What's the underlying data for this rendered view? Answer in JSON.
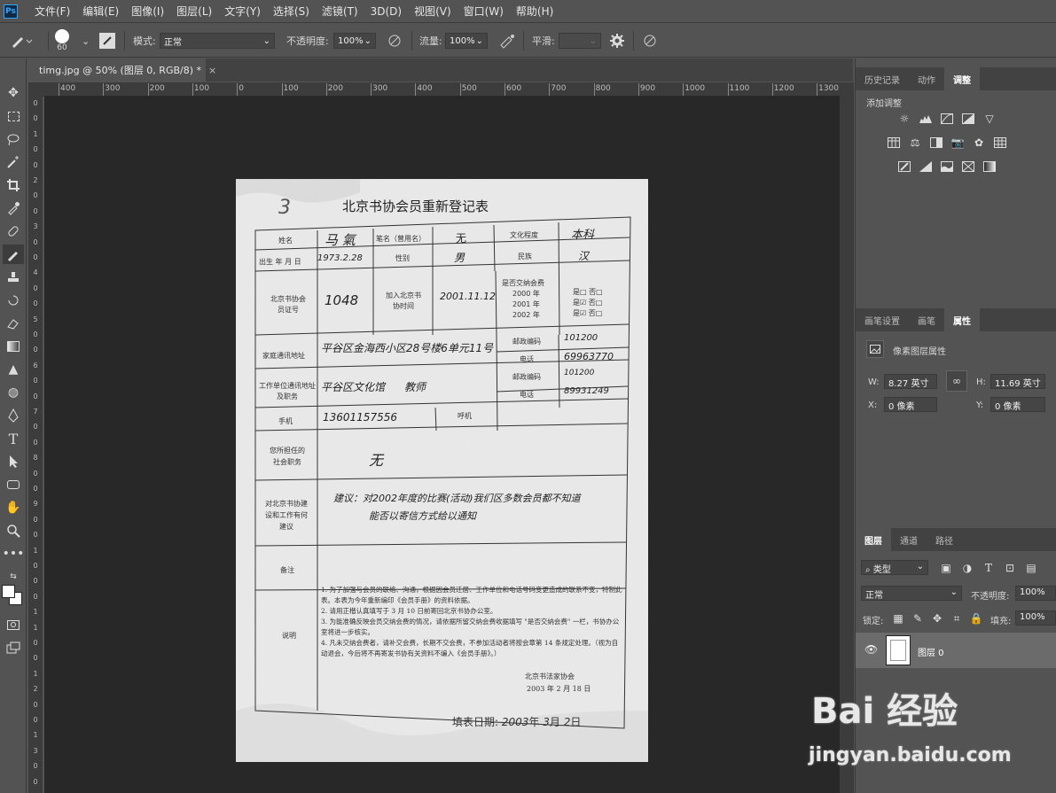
{
  "menubar": {
    "logo": "Ps",
    "items": [
      "文件(F)",
      "编辑(E)",
      "图像(I)",
      "图层(L)",
      "文字(Y)",
      "选择(S)",
      "滤镜(T)",
      "3D(D)",
      "视图(V)",
      "窗口(W)",
      "帮助(H)"
    ]
  },
  "options": {
    "brush_size": "60",
    "mode_label": "模式:",
    "mode_value": "正常",
    "opacity_label": "不透明度:",
    "opacity_value": "100%",
    "flow_label": "流量:",
    "flow_value": "100%",
    "smooth_label": "平滑:"
  },
  "document_tab": {
    "title": "timg.jpg @ 50% (图层 0, RGB/8) *",
    "close": "×"
  },
  "ruler": {
    "h_labels": [
      "400",
      "300",
      "200",
      "100",
      "0",
      "100",
      "200",
      "300",
      "400",
      "500",
      "600",
      "700",
      "800",
      "900",
      "1000",
      "1100",
      "1200",
      "1300"
    ],
    "v_labels": [
      "0",
      "0",
      "1",
      "0",
      "0",
      "2",
      "0",
      "0",
      "3",
      "0",
      "0",
      "4",
      "0",
      "0",
      "5",
      "0",
      "0",
      "6",
      "0",
      "0",
      "7",
      "0",
      "0",
      "8",
      "0",
      "0",
      "9",
      "0",
      "0",
      "1",
      "0",
      "0",
      "0",
      "1",
      "1",
      "0",
      "0",
      "1",
      "2",
      "0",
      "0",
      "1",
      "3",
      "0",
      "0"
    ]
  },
  "form": {
    "title": "北京书协会员重新登记表",
    "corner_number": "3",
    "labels": {
      "name": "姓名",
      "pen_name": "笔名（曾用名）",
      "education": "文化程度",
      "birth": "出生 年 月 日",
      "gender": "性别",
      "ethnicity": "民族",
      "member_no": "北京书协会员证号",
      "join_time": "加入北京书协时间",
      "dues": "是否交纳会费",
      "y2000": "2000 年",
      "y2001": "2001 年",
      "y2002": "2002 年",
      "yes": "是",
      "no": "否",
      "home_addr": "家庭通讯地址",
      "zip": "邮政编码",
      "phone": "电话",
      "work": "工作单位通讯地址及职务",
      "work_zip": "邮政编码",
      "work_phone": "电话",
      "mobile": "手机",
      "pager": "呼机",
      "social": "您所担任的社会职务",
      "suggest": "对北京书协建设和工作有何建议",
      "remark": "备注",
      "explain": "说明",
      "fill_date_label": "填表日期:"
    },
    "values": {
      "name": "马 氣",
      "pen_name": "无",
      "education": "本科",
      "birth": "1973.2.28",
      "gender": "男",
      "ethnicity": "汉",
      "member_no": "1048",
      "join_time": "2001.11.12",
      "home_addr": "平谷区金海西小区28号楼6单元11号",
      "zip": "101200",
      "phone": "69963770",
      "work": "平谷区文化馆",
      "work_role": "教师",
      "work_zip": "101200",
      "work_phone": "89931249",
      "mobile": "13601157556",
      "social": "无",
      "suggest_1": "建议：对2002年度的比赛(活动)我们区多数会员都不知道",
      "suggest_2": "能否以寄信方式给以通知",
      "fill_year": "2003",
      "fill_month": "3",
      "fill_day": "2",
      "year_char": "年",
      "month_char": "月",
      "day_char": "日"
    },
    "notes": [
      "1. 为了加强与会员的联络、沟通，根据因会员迁居、工作单位和电话号码变更造成的联系不变，特制此表。本表为今年重新编印《会员手册》的资料依据。",
      "2. 请用正楷认真填写于 3 月 10 日前寄回北京书协办公室。",
      "3. 为能准确反映会员交纳会费的情况，请依据所留交纳会费收据填写 \"是否交纳会费\" 一栏，书协办公室将进一步核实。",
      "4. 凡未交纳会费者，请补交会费，长期不交会费，不参加活动者将按会章第 14 条规定处理。（视为自动退会，今后将不再寄发书协有关资料不编入《会员手册》。）"
    ],
    "notes_sign": "北京书法家协会",
    "notes_date": "2003 年 2 月 18 日"
  },
  "panel_top": {
    "tabs": [
      "历史记录",
      "动作",
      "调整"
    ],
    "title": "添加调整"
  },
  "panel_props": {
    "tabs": [
      "画笔设置",
      "画笔",
      "属性"
    ],
    "title": "像素图层属性",
    "w_label": "W:",
    "w_value": "8.27 英寸",
    "h_label": "H:",
    "h_value": "11.69 英寸",
    "x_label": "X:",
    "x_value": "0 像素",
    "y_label": "Y:",
    "y_value": "0 像素"
  },
  "panel_layers": {
    "tabs": [
      "图层",
      "通道",
      "路径"
    ],
    "filter": "类型",
    "blend": "正常",
    "opacity_label": "不透明度:",
    "opacity_value": "100%",
    "lock_label": "锁定:",
    "fill_label": "填充:",
    "fill_value": "100%",
    "layer_name": "图层 0"
  },
  "watermark": {
    "logo": "Bai 经验",
    "url": "jingyan.baidu.com"
  }
}
